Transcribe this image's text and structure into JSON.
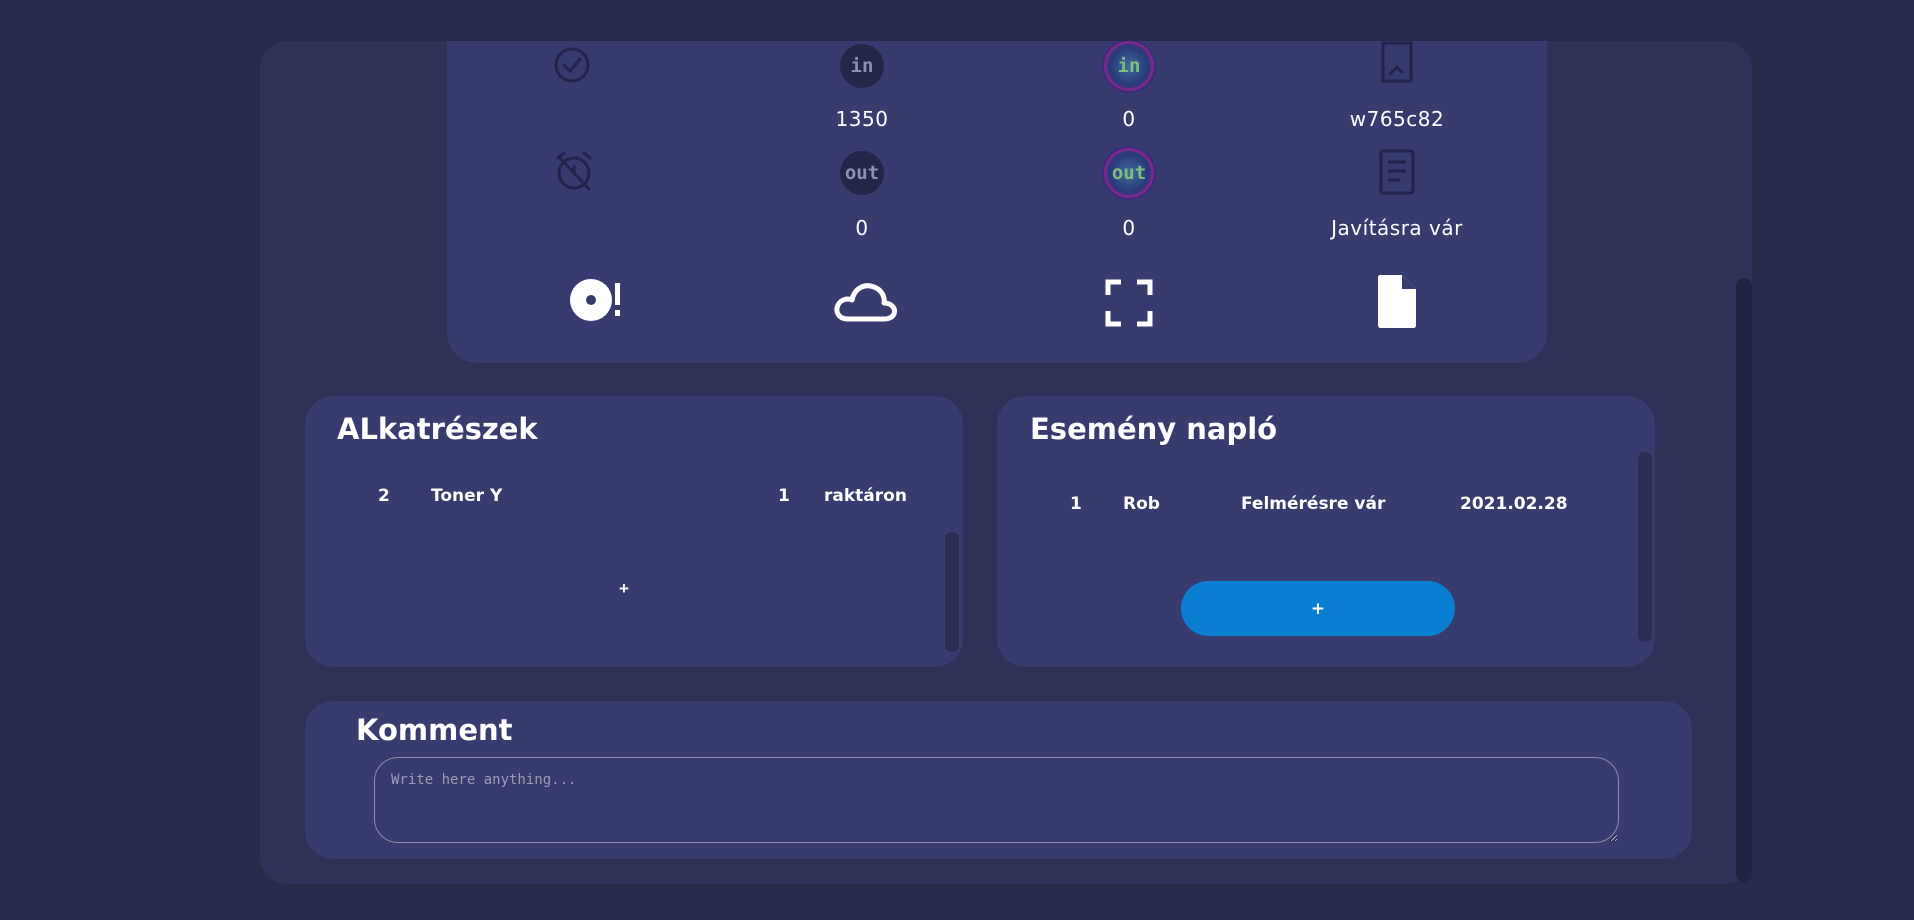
{
  "status_grid": {
    "row1": {
      "icon1": "check-icon",
      "counter_in": "1350",
      "color_counter_in": "0",
      "model": "w765c82"
    },
    "row2": {
      "icon1": "alarm-off-icon",
      "out_label": "out",
      "counter_out": "0",
      "color_out_label": "out",
      "color_counter_out": "0",
      "status": "Javításra vár"
    },
    "in_label": "in",
    "color_in_label": "in",
    "actions": [
      "disc-alert-icon",
      "cloud-icon",
      "fullscreen-icon",
      "file-icon"
    ]
  },
  "parts": {
    "title": "ALkatrészek",
    "rows": [
      {
        "id": "2",
        "name": "Toner Y",
        "qty": "1",
        "status": "raktáron"
      }
    ],
    "add_label": "+"
  },
  "events": {
    "title": "Esemény napló",
    "rows": [
      {
        "id": "1",
        "user": "Rob",
        "status": "Felmérésre vár",
        "date": "2021.02.28"
      }
    ],
    "add_label": "+"
  },
  "comment": {
    "title": "Komment",
    "placeholder": "Write here anything..."
  },
  "colors": {
    "page_bg": "#262a4b",
    "outer_bg": "#2e3258",
    "card_bg": "#373b6d",
    "accent_blue": "#0a7fd1"
  }
}
